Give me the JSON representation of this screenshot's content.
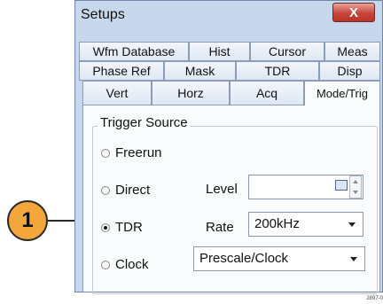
{
  "callout": {
    "number": "1"
  },
  "window": {
    "title": "Setups",
    "close_label": "X"
  },
  "tabs": {
    "row1": [
      "Wfm Database",
      "Hist",
      "Cursor",
      "Meas"
    ],
    "row2": [
      "Phase Ref",
      "Mask",
      "TDR",
      "Disp"
    ],
    "row3": [
      "Vert",
      "Horz",
      "Acq",
      "Mode/Trig"
    ],
    "active": "Mode/Trig"
  },
  "trigger_source": {
    "label": "Trigger Source",
    "options": [
      "Freerun",
      "Direct",
      "TDR",
      "Clock"
    ],
    "selected": "TDR"
  },
  "level": {
    "label": "Level",
    "value": ""
  },
  "rate": {
    "label": "Rate",
    "value": "200kHz"
  },
  "clock_mode": {
    "value": "Prescale/Clock"
  },
  "figure_code": "2897-0"
}
